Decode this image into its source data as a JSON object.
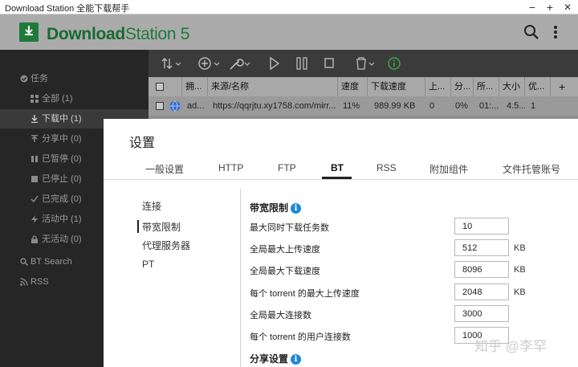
{
  "window": {
    "title": "Download Station 全能下载帮手",
    "minimize": "−",
    "maximize": "+",
    "close": "✕"
  },
  "header": {
    "app_name_bold": "Download",
    "app_name_light": "Station 5",
    "brand_color": "#1f7a3a"
  },
  "sidebar": {
    "section_tasks": "任务",
    "items": [
      {
        "label": "全部 (1)",
        "icon": "grid-icon"
      },
      {
        "label": "下载中 (1)",
        "icon": "download-arrow-icon",
        "active": true
      },
      {
        "label": "分享中 (0)",
        "icon": "upload-arrow-icon"
      },
      {
        "label": "已暂停 (0)",
        "icon": "pause-icon"
      },
      {
        "label": "已停止 (0)",
        "icon": "stop-icon"
      },
      {
        "label": "已完成 (0)",
        "icon": "check-icon"
      },
      {
        "label": "活动中 (1)",
        "icon": "lightning-icon"
      },
      {
        "label": "无活动 (0)",
        "icon": "lock-icon"
      }
    ],
    "bt_search": "BT Search",
    "rss": "RSS"
  },
  "table": {
    "columns": [
      "拥...",
      "来源/名称",
      "速度",
      "下载速度",
      "上...",
      "分...",
      "所...",
      "大小",
      "优..."
    ],
    "add_column": "+",
    "rows": [
      {
        "owner": "ad...",
        "source": "https://qqrjtu.xy1758.com/mirr...",
        "progress": "11%",
        "speed": "989.99 KB",
        "upload": "0",
        "share": "0%",
        "time": "01:...",
        "size": "4.5...",
        "priority": "1"
      }
    ]
  },
  "dialog": {
    "title": "设置",
    "tabs": [
      "一般设置",
      "HTTP",
      "FTP",
      "BT",
      "RSS",
      "附加组件",
      "文件托管账号"
    ],
    "active_tab": "BT",
    "subnav": [
      "连接",
      "带宽限制",
      "代理服务器",
      "PT"
    ],
    "active_subnav": "带宽限制",
    "section_bandwidth": "带宽限制",
    "fields": [
      {
        "label": "最大同时下载任务数",
        "value": "10",
        "unit": ""
      },
      {
        "label": "全局最大上传速度",
        "value": "512",
        "unit": "KB"
      },
      {
        "label": "全局最大下载速度",
        "value": "8096",
        "unit": "KB"
      },
      {
        "label": "每个 torrent 的最大上传速度",
        "value": "2048",
        "unit": "KB"
      },
      {
        "label": "全局最大连接数",
        "value": "3000",
        "unit": ""
      },
      {
        "label": "每个 torrent 的用户连接数",
        "value": "1000",
        "unit": ""
      }
    ],
    "section_share": "分享设置"
  },
  "watermark": "知乎 @李罕",
  "colors": {
    "info_blue": "#1e88d8",
    "sidebar_bg": "#262626",
    "toolbar_bg": "#3b3b3b"
  }
}
